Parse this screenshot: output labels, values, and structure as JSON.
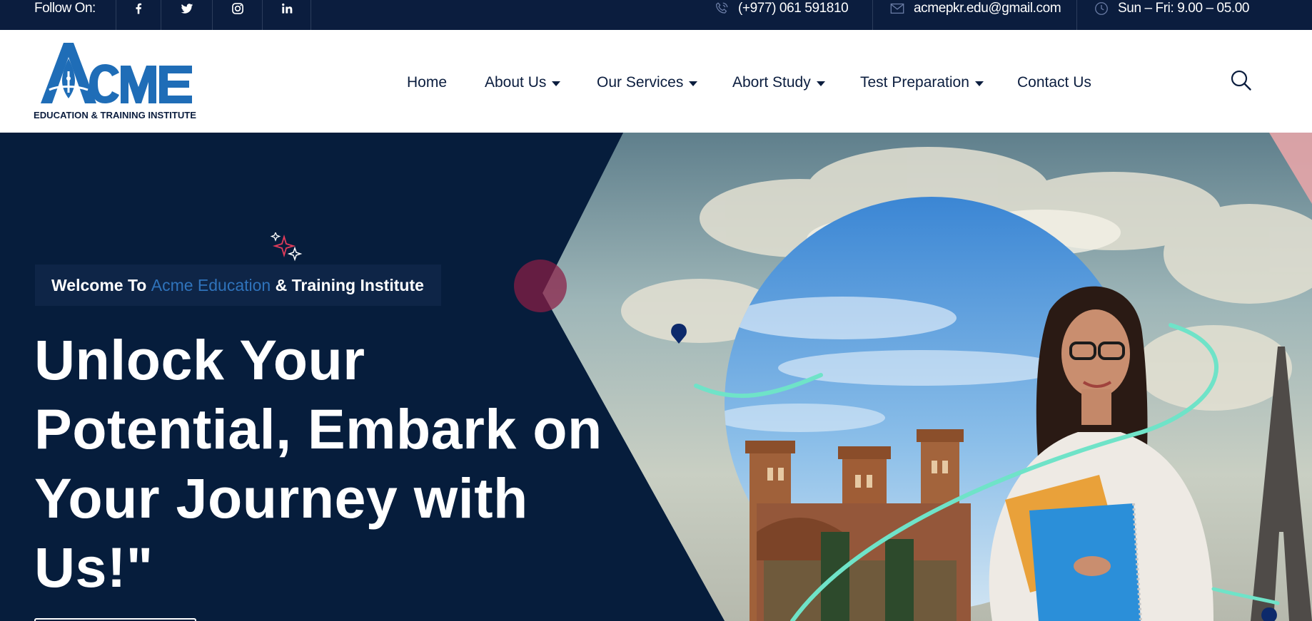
{
  "topbar": {
    "follow_label": "Follow On:",
    "socials": [
      {
        "icon": "facebook-icon"
      },
      {
        "icon": "twitter-icon"
      },
      {
        "icon": "instagram-icon"
      },
      {
        "icon": "linkedin-icon"
      }
    ],
    "phone": "(+977) 061 591810",
    "email": "acmepkr.edu@gmail.com",
    "hours": "Sun – Fri: 9.00 – 05.00"
  },
  "logo": {
    "brand": "ACME",
    "tagline": "EDUCATION & TRAINING INSTITUTE"
  },
  "nav": {
    "items": [
      {
        "label": "Home",
        "has_dropdown": false
      },
      {
        "label": "About Us",
        "has_dropdown": true
      },
      {
        "label": "Our Services",
        "has_dropdown": true
      },
      {
        "label": "Abort Study",
        "has_dropdown": true
      },
      {
        "label": "Test Preparation",
        "has_dropdown": true
      },
      {
        "label": "Contact Us",
        "has_dropdown": false
      }
    ],
    "search_icon": "search-icon"
  },
  "hero": {
    "welcome_prefix": "Welcome To ",
    "welcome_accent": "Acme Education",
    "welcome_suffix": " & Training Institute",
    "headline_lines": [
      "Unlock Your",
      "Potential, Embark on",
      "Your Journey with",
      "Us!\""
    ]
  },
  "colors": {
    "topbar_bg": "#0b1d3e",
    "hero_bg": "#061d3c",
    "brand_blue": "#1f6db7",
    "accent_blue": "#2f73bb",
    "nav_text": "#0b1d3e",
    "swoosh": "#6fe3c8"
  }
}
